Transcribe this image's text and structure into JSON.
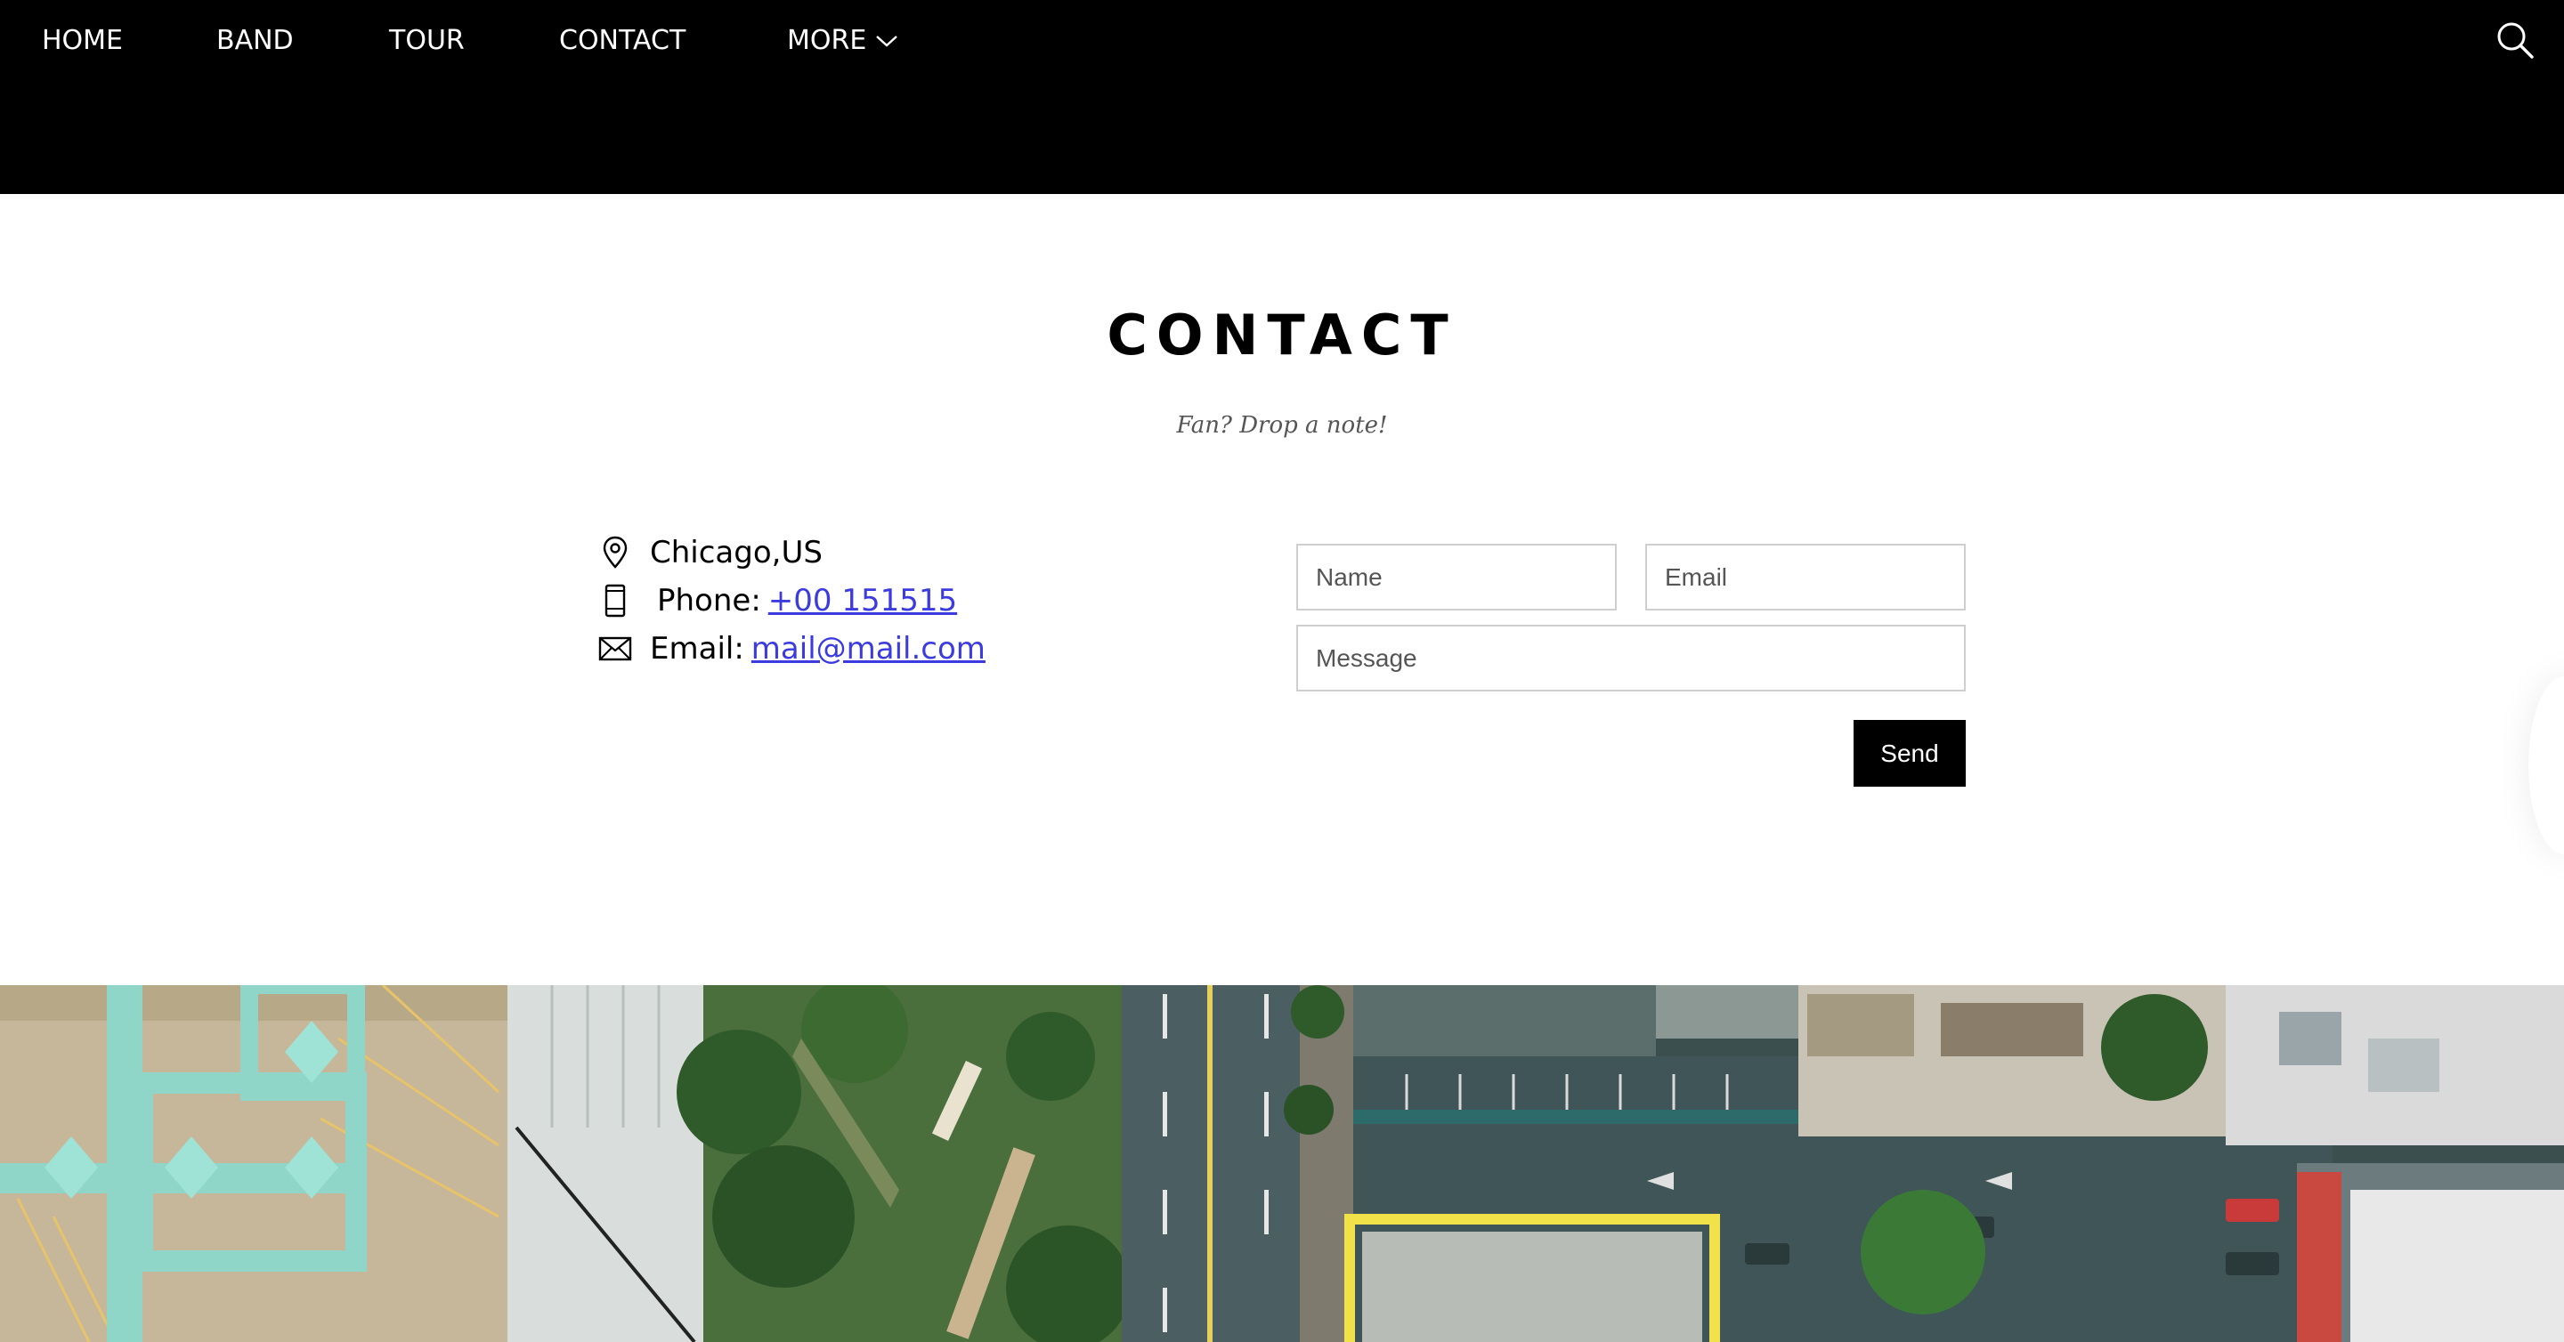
{
  "nav": {
    "items": [
      {
        "label": "HOME"
      },
      {
        "label": "BAND"
      },
      {
        "label": "TOUR"
      },
      {
        "label": "CONTACT"
      },
      {
        "label": "MORE"
      }
    ],
    "more_icon": "chevron-down-icon",
    "search_icon": "search-icon"
  },
  "contact": {
    "title": "CONTACT",
    "subtitle": "Fan? Drop a note!",
    "location": "Chicago,US",
    "phone_label": "Phone:",
    "phone_value": "+00 151515",
    "email_label": "Email:",
    "email_value": "mail@mail.com"
  },
  "form": {
    "name_placeholder": "Name",
    "email_placeholder": "Email",
    "message_placeholder": "Message",
    "send_label": "Send"
  },
  "colors": {
    "nav_bg": "#000000",
    "link": "#3b3be0",
    "button_bg": "#000000"
  }
}
